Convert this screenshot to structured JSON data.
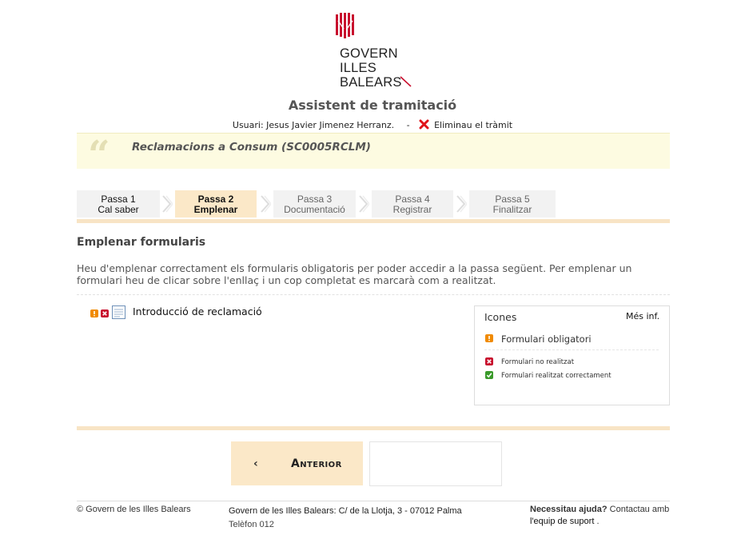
{
  "logo": {
    "line1": "GOVERN",
    "line2": "ILLES",
    "line3": "BALEARS",
    "color": "#c8102e"
  },
  "header": {
    "title": "Assistent de tramitació"
  },
  "user": {
    "label": "Usuari:",
    "name": "Jesus Javier Jimenez Herranz.",
    "separator": "-",
    "delete_label": "Eliminau el tràmit"
  },
  "procedure": {
    "title": "Reclamacions a Consum (SC0005RCLM)"
  },
  "steps": [
    {
      "line1": "Passa 1",
      "line2": "Cal saber"
    },
    {
      "line1": "Passa 2",
      "line2": "Emplenar"
    },
    {
      "line1": "Passa 3",
      "line2": "Documentació"
    },
    {
      "line1": "Passa 4",
      "line2": "Registrar"
    },
    {
      "line1": "Passa 5",
      "line2": "Finalitzar"
    }
  ],
  "section": {
    "title": "Emplenar formularis",
    "description": "Heu d'emplenar correctament els formularis obligatoris per poder accedir a la passa següent. Per emplenar un formulari heu de clicar sobre l'enllaç i un cop completat es marcarà com a realitzat."
  },
  "form": {
    "name": "Introducció de reclamació",
    "required": true,
    "done": false
  },
  "icons_box": {
    "title": "Icones",
    "more": "Més inf.",
    "required": "Formulari obligatori",
    "not_done": "Formulari no realitzat",
    "done": "Formulari realitzat correctament"
  },
  "nav": {
    "prev_label": "Anterior",
    "prev_arrow": "‹"
  },
  "footer": {
    "copyright": "© Govern de les Illes Balears",
    "address": "Govern de les Illes Balears: C/ de la Llotja, 3 - 07012 Palma",
    "phone": "Telèfon 012",
    "help_bold": "Necessitau ajuda?",
    "help_text": "Contactau amb",
    "help_link": "l'equip de suport",
    "help_end": "."
  }
}
